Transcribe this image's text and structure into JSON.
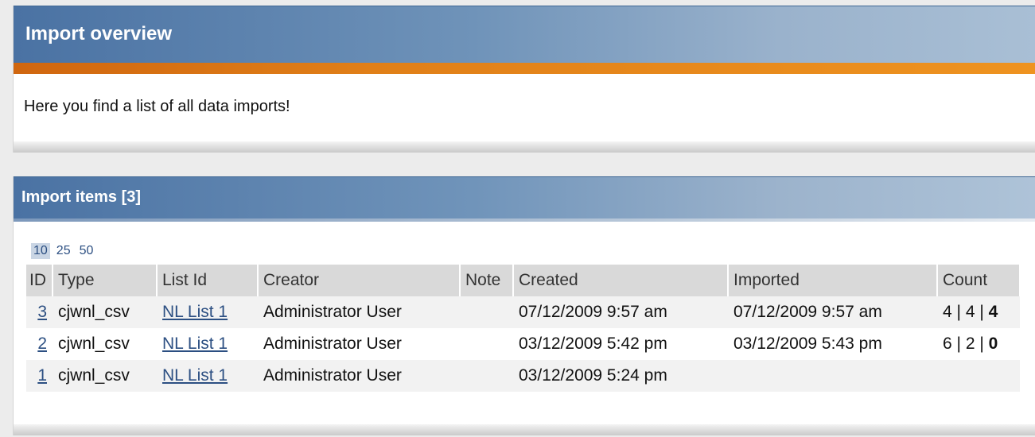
{
  "overview": {
    "title": "Import overview",
    "intro": "Here you find a list of all data imports!"
  },
  "items_panel": {
    "title": "Import items [3]",
    "page_sizes": [
      "10",
      "25",
      "50"
    ],
    "active_page_size": "10",
    "columns": [
      "ID",
      "Type",
      "List Id",
      "Creator",
      "Note",
      "Created",
      "Imported",
      "Count"
    ],
    "rows": [
      {
        "id": "3",
        "type": "cjwnl_csv",
        "list_id": "NL List 1",
        "creator": "Administrator User",
        "note": "",
        "created": "07/12/2009 9:57 am",
        "imported": "07/12/2009 9:57 am",
        "count_a": "4",
        "count_b": "4",
        "count_c": "4"
      },
      {
        "id": "2",
        "type": "cjwnl_csv",
        "list_id": "NL List 1",
        "creator": "Administrator User",
        "note": "",
        "created": "03/12/2009 5:42 pm",
        "imported": "03/12/2009 5:43 pm",
        "count_a": "6",
        "count_b": "2",
        "count_c": "0"
      },
      {
        "id": "1",
        "type": "cjwnl_csv",
        "list_id": "NL List 1",
        "creator": "Administrator User",
        "note": "",
        "created": "03/12/2009 5:24 pm",
        "imported": "",
        "count_a": "",
        "count_b": "",
        "count_c": ""
      }
    ]
  },
  "colors": {
    "header_blue": "#4a72a3",
    "accent_orange": "#e07f18",
    "link_blue": "#2c4f82"
  }
}
